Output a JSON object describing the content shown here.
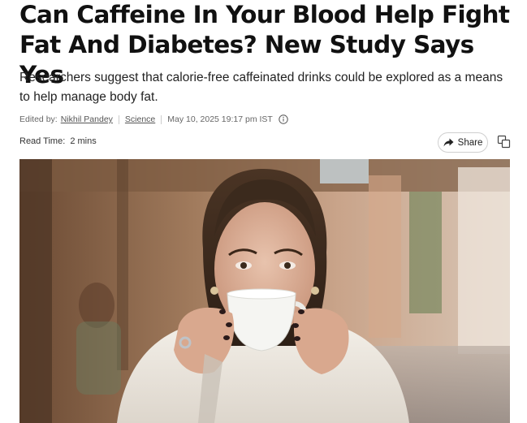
{
  "article": {
    "title": "Can Caffeine In Your Blood Help Fight Fat And Diabetes? New Study Says Yes",
    "subtitle": "Researchers suggest that calorie-free caffeinated drinks could be explored as a means to help manage body fat.",
    "meta": {
      "edited_by_label": "Edited by:",
      "author": "Nikhil Pandey",
      "category": "Science",
      "timestamp": "May 10, 2025 19:17 pm IST"
    },
    "read_time": {
      "label": "Read Time:",
      "value": "2 mins"
    },
    "actions": {
      "share_label": "Share"
    },
    "icons": {
      "info": "info-icon",
      "share": "share-arrow-icon",
      "copy": "copy-icon"
    }
  }
}
